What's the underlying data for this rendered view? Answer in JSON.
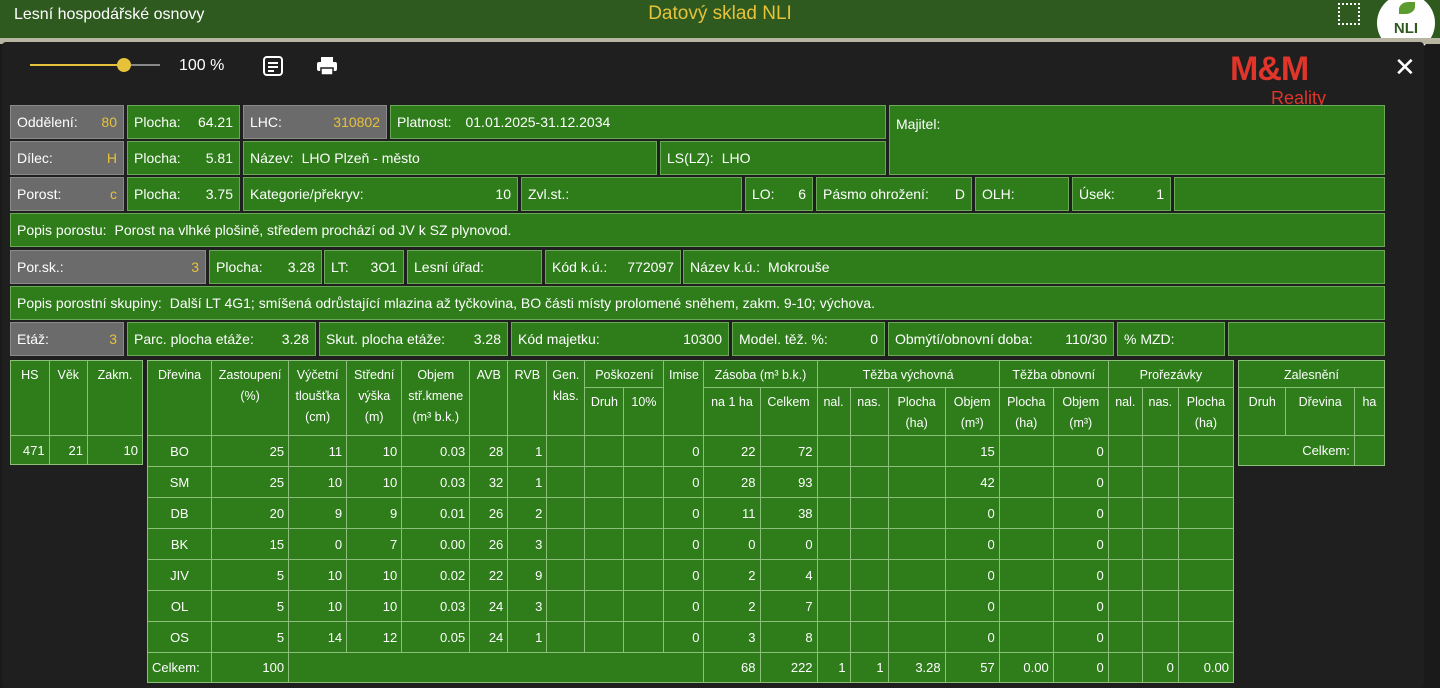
{
  "topbar": {
    "app_title": "Lesní hospodářské osnovy",
    "center_title": "Datový sklad NLI",
    "logo_text": "NLI"
  },
  "toolbar": {
    "zoom_label": "100 %",
    "zoom_level": 1.0,
    "brand_main": "M&M",
    "brand_sub": "Reality",
    "close_label": "✕"
  },
  "header": {
    "oddeleni_label": "Oddělení:",
    "oddeleni": "80",
    "plocha1_label": "Plocha:",
    "plocha1": "64.21",
    "lhc_label": "LHC:",
    "lhc": "310802",
    "platnost_label": "Platnost:",
    "platnost": "01.01.2025-31.12.2034",
    "majitel_label": "Majitel:",
    "dilec_label": "Dílec:",
    "dilec": "H",
    "plocha2_label": "Plocha:",
    "plocha2": "5.81",
    "nazev_label": "Název:",
    "nazev": "LHO Plzeň - město",
    "lslz_label": "LS(LZ):",
    "lslz": "LHO",
    "porost_label": "Porost:",
    "porost": "c",
    "plocha3_label": "Plocha:",
    "plocha3": "3.75",
    "kategorie_label": "Kategorie/překryv:",
    "kategorie": "10",
    "zvlst_label": "Zvl.st.:",
    "lo_label": "LO:",
    "lo": "6",
    "pasmo_label": "Pásmo ohrožení:",
    "pasmo": "D",
    "olh_label": "OLH:",
    "usek_label": "Úsek:",
    "usek": "1",
    "popis_porostu_label": "Popis porostu:",
    "popis_porostu": "Porost na vlhké plošině, středem prochází od JV k SZ plynovod.",
    "porsk_label": "Por.sk.:",
    "porsk": "3",
    "plocha4_label": "Plocha:",
    "plocha4": "3.28",
    "lt_label": "LT:",
    "lt": "3O1",
    "lesni_urad_label": "Lesní úřad:",
    "kodku_label": "Kód k.ú.:",
    "kodku": "772097",
    "nazevku_label": "Název k.ú.:",
    "nazevku": "Mokrouše",
    "popis_skupiny_label": "Popis porostní skupiny:",
    "popis_skupiny": "Další LT 4G1; smíšená odrůstající mlazina až tyčkovina, BO části místy prolomené sněhem, zakm. 9-10; výchova.",
    "etaz_label": "Etáž:",
    "etaz": "3",
    "parc_label": "Parc. plocha etáže:",
    "parc": "3.28",
    "skut_label": "Skut. plocha etáže:",
    "skut": "3.28",
    "kodmaj_label": "Kód majetku:",
    "kodmaj": "10300",
    "model_label": "Model. těž. %:",
    "model": "0",
    "obmyti_label": "Obmýtí/obnovní doba:",
    "obmyti": "110/30",
    "mzd_label": "% MZD:"
  },
  "left_table": {
    "headers": [
      "HS",
      "Věk",
      "Zakm."
    ],
    "values": [
      "471",
      "21",
      "10"
    ]
  },
  "main_table": {
    "h": {
      "drevina": "Dřevina",
      "zastoupeni": "Zastoupení",
      "zastoupeni2": "(%)",
      "vycetni": "Výčetní",
      "vycetni2": "tloušťka",
      "vycetni3": "(cm)",
      "stredni": "Střední",
      "stredni2": "výška",
      "stredni3": "(m)",
      "objem": "Objem",
      "objem2": "stř.kmene",
      "objem3": "(m³ b.k.)",
      "avb": "AVB",
      "rvb": "RVB",
      "gen": "Gen.",
      "gen2": "klas.",
      "poskozeni": "Poškození",
      "druh": "Druh",
      "pct10": "10%",
      "imise": "Imise",
      "zasoba": "Zásoba (m³ b.k.)",
      "na1ha": "na 1 ha",
      "celkem": "Celkem",
      "tezba_v": "Těžba výchovná",
      "nal": "nal.",
      "nas": "nas.",
      "plocha": "Plocha",
      "plocha2": "(ha)",
      "objem_t": "Objem",
      "objem_t2": "(m³)",
      "tezba_o": "Těžba obnovní",
      "prorezavky": "Prořezávky"
    },
    "rows": [
      {
        "d": "BO",
        "z": "25",
        "t": "11",
        "v": "10",
        "o": "0.03",
        "avb": "28",
        "rvb": "1",
        "im": "0",
        "ha": "22",
        "c": "72",
        "tvo": "15",
        "too": "0"
      },
      {
        "d": "SM",
        "z": "25",
        "t": "10",
        "v": "10",
        "o": "0.03",
        "avb": "32",
        "rvb": "1",
        "im": "0",
        "ha": "28",
        "c": "93",
        "tvo": "42",
        "too": "0"
      },
      {
        "d": "DB",
        "z": "20",
        "t": "9",
        "v": "9",
        "o": "0.01",
        "avb": "26",
        "rvb": "2",
        "im": "0",
        "ha": "11",
        "c": "38",
        "tvo": "0",
        "too": "0"
      },
      {
        "d": "BK",
        "z": "15",
        "t": "0",
        "v": "7",
        "o": "0.00",
        "avb": "26",
        "rvb": "3",
        "im": "0",
        "ha": "0",
        "c": "0",
        "tvo": "0",
        "too": "0"
      },
      {
        "d": "JIV",
        "z": "5",
        "t": "10",
        "v": "10",
        "o": "0.02",
        "avb": "22",
        "rvb": "9",
        "im": "0",
        "ha": "2",
        "c": "4",
        "tvo": "0",
        "too": "0"
      },
      {
        "d": "OL",
        "z": "5",
        "t": "10",
        "v": "10",
        "o": "0.03",
        "avb": "24",
        "rvb": "3",
        "im": "0",
        "ha": "2",
        "c": "7",
        "tvo": "0",
        "too": "0"
      },
      {
        "d": "OS",
        "z": "5",
        "t": "14",
        "v": "12",
        "o": "0.05",
        "avb": "24",
        "rvb": "1",
        "im": "0",
        "ha": "3",
        "c": "8",
        "tvo": "0",
        "too": "0"
      }
    ],
    "total": {
      "label": "Celkem:",
      "z": "100",
      "ha": "68",
      "c": "222",
      "nal": "1",
      "nas": "1",
      "tvp": "3.28",
      "tvo": "57",
      "top": "0.00",
      "too": "0",
      "pnas": "0",
      "pp": "0.00"
    }
  },
  "right_table": {
    "title": "Zalesnění",
    "druh": "Druh",
    "drevina": "Dřevina",
    "ha": "ha",
    "celkem": "Celkem:"
  }
}
